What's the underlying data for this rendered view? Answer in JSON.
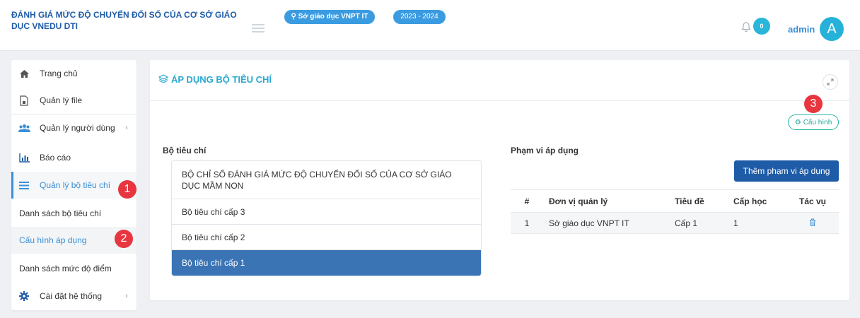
{
  "header": {
    "title": "ĐÁNH GIÁ MỨC ĐỘ CHUYỂN ĐỔI SỐ CỦA CƠ SỞ GIÁO DỤC VNEDU DTI",
    "unit_badge": "Sở giáo dục VNPT IT",
    "year_badge": "2023 - 2024",
    "notification_count": "0",
    "user_name": "admin",
    "avatar_letter": "A"
  },
  "sidebar": {
    "items": [
      {
        "label": "Trang chủ",
        "icon": "home-icon"
      },
      {
        "label": "Quản lý file",
        "icon": "file-icon"
      },
      {
        "label": "Quản lý người dùng",
        "icon": "users-icon"
      },
      {
        "label": "Báo cáo",
        "icon": "bar-chart-icon"
      },
      {
        "label": "Quản lý bộ tiêu chí",
        "icon": "list-icon"
      }
    ],
    "sub_items": [
      {
        "label": "Danh sách bộ tiêu chí"
      },
      {
        "label": "Cấu hình áp dụng"
      },
      {
        "label": "Danh sách mức độ điểm"
      }
    ],
    "settings": {
      "label": "Cài đặt hệ thống",
      "icon": "gear-icon"
    }
  },
  "markers": [
    "1",
    "2",
    "3"
  ],
  "card": {
    "title": "ÁP DỤNG BỘ TIÊU CHÍ",
    "config_button": "Cấu hình",
    "criteria_label": "Bộ tiêu chí",
    "criteria": [
      "BỘ CHỈ SỐ ĐÁNH GIÁ MỨC ĐỘ CHUYỂN ĐỔI SỐ CỦA CƠ SỞ GIÁO DỤC MẦM NON",
      "Bộ tiêu chí cấp 3",
      "Bộ tiêu chí cấp 2",
      "Bộ tiêu chí cấp 1"
    ],
    "scope_label": "Phạm vi áp dụng",
    "add_scope_button": "Thêm phạm vi áp dụng",
    "table": {
      "headers": [
        "#",
        "Đơn vị quản lý",
        "Tiêu đề",
        "Cấp học",
        "Tác vụ"
      ],
      "rows": [
        [
          "1",
          "Sở giáo dục VNPT IT",
          "Cấp 1",
          "1"
        ]
      ]
    }
  },
  "colors": {
    "brand": "#1f5ca8",
    "accent": "#3b8fd6",
    "teal": "#29b6a8",
    "marker": "#e73640",
    "selected_row": "#3a74b5"
  }
}
